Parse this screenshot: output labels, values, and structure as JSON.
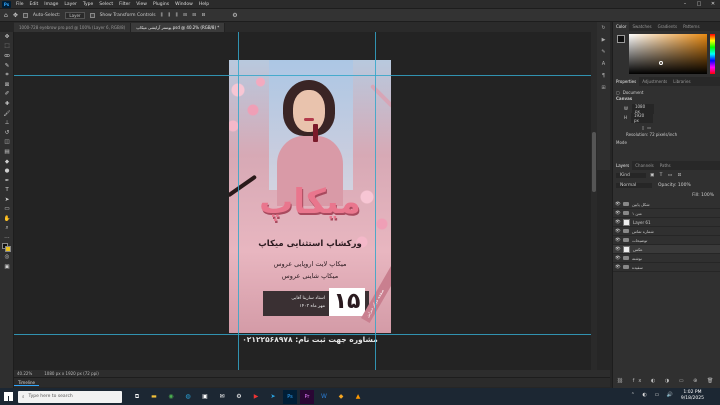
{
  "menu": {
    "items": [
      "File",
      "Edit",
      "Image",
      "Layer",
      "Type",
      "Select",
      "Filter",
      "View",
      "Plugins",
      "Window",
      "Help"
    ]
  },
  "options": {
    "auto_select": "Auto-Select:",
    "layer": "Layer",
    "transform": "Show Transform Controls"
  },
  "tabs": [
    {
      "label": "1000-728 eyebrow pro.psd @ 100% (Layer 6, RGB/8)"
    },
    {
      "label": "پوستر آرایشی میکاپ.psd @ 40.2% (RGB/8) *"
    }
  ],
  "poster": {
    "headline": "میکاپ",
    "subtitle": "ورکشاپ استثنایی میکاپ",
    "line1": "میکاپ لایت اروپایی عروس",
    "line2": "میکاپ شاینی عروس",
    "big_number": "۱۵",
    "teacher": "استاد سارینا آقایی",
    "date": "مهر ماه ۱۴۰۳",
    "side_text": "صفحه مرکز دیزاین",
    "phone": "مشاوره جهت ثبت نام: ۰۲۱۲۲۵۶۸۹۷۸"
  },
  "status": {
    "zoom": "40.22%",
    "doc": "1080 px x 1920 px (72 ppi)"
  },
  "timeline": {
    "label": "Timeline"
  },
  "color_panel": {
    "tabs": [
      "Color",
      "Swatches",
      "Gradients",
      "Patterns"
    ]
  },
  "properties": {
    "tabs": [
      "Properties",
      "Adjustments",
      "Libraries"
    ],
    "doc_label": "Document",
    "canvas_label": "Canvas",
    "w_label": "W",
    "w_value": "1080 px",
    "h_label": "H",
    "h_value": "1920 px",
    "resolution": "Resolution: 72 pixels/inch",
    "mode": "Mode"
  },
  "layers": {
    "tabs": [
      "Layers",
      "Channels",
      "Paths"
    ],
    "filter": "Kind",
    "blend": "Normal",
    "opacity": "Opacity: 100%",
    "fill": "Fill: 100%",
    "items": [
      "شکل پایین",
      "متن ۱",
      "Layer 61",
      "شماره تماس",
      "توضیحات",
      "عکس",
      "نوشته",
      "سفیده"
    ]
  },
  "taskbar": {
    "search": "Type here to search",
    "time": "1:02 PM",
    "date": "9/18/2025"
  }
}
